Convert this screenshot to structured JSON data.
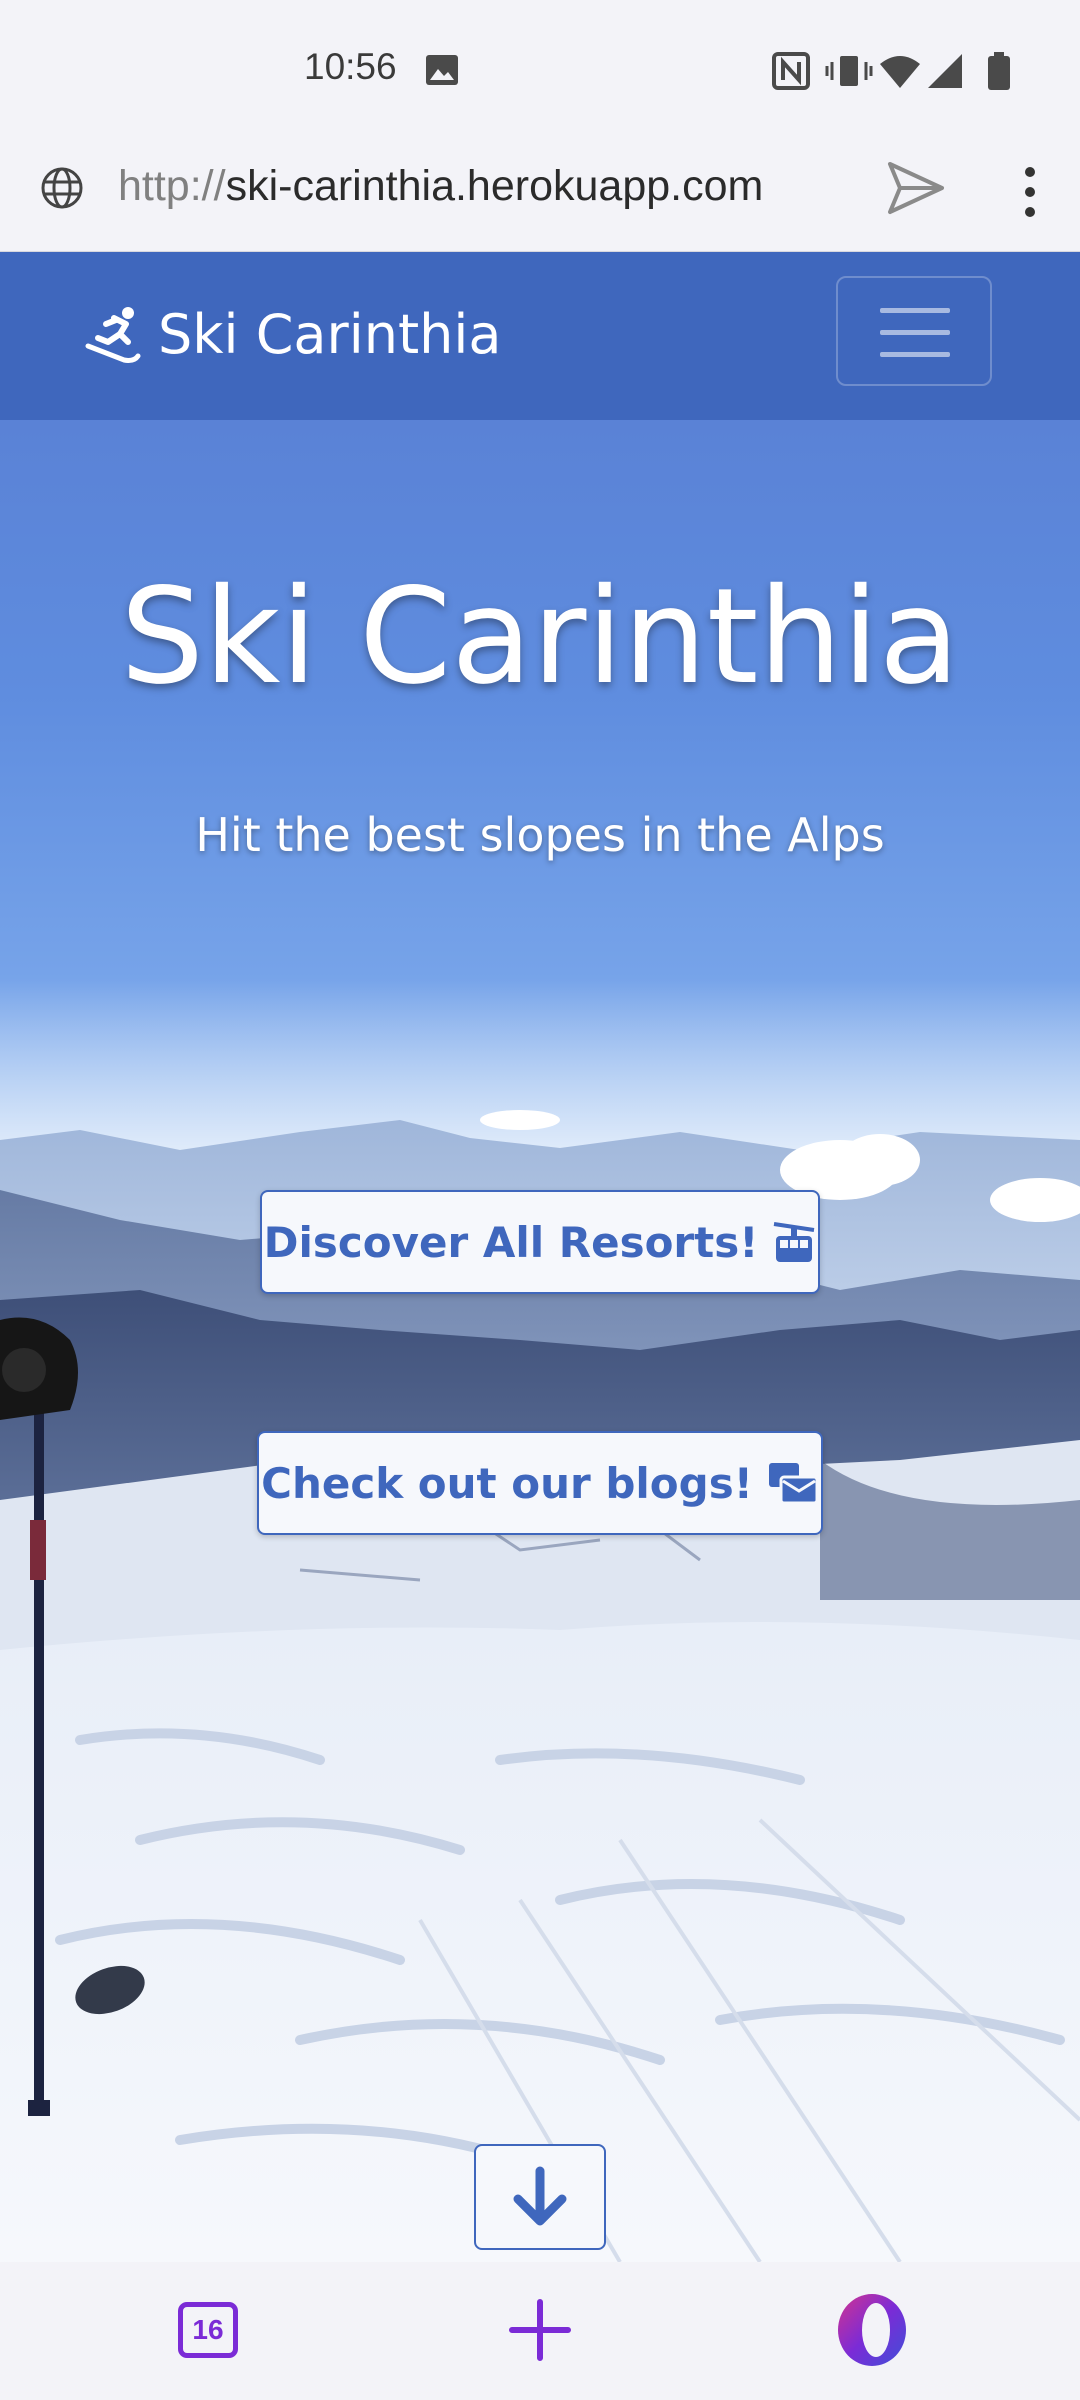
{
  "status_bar": {
    "time": "10:56",
    "icons": [
      "image-icon",
      "nfc-icon",
      "vibrate-icon",
      "wifi-icon",
      "signal-icon",
      "battery-icon"
    ]
  },
  "address_bar": {
    "url_scheme": "http://",
    "url_host": "ski-carinthia.herokuapp.com",
    "icons": [
      "globe-icon",
      "send-icon",
      "more-vertical-icon"
    ]
  },
  "navbar": {
    "brand": "Ski Carinthia",
    "brand_icon": "skier-icon",
    "menu_icon": "hamburger-icon",
    "color": "#3f67bd"
  },
  "hero": {
    "title": "Ski Carinthia",
    "subtitle": "Hit the best slopes in the Alps",
    "resorts_button": "Discover All Resorts!",
    "resorts_icon": "cable-car-icon",
    "blogs_button": "Check out our blogs!",
    "blogs_icon": "mail-bulk-icon",
    "scroll_icon": "arrow-down-icon"
  },
  "bottom_bar": {
    "tab_count": "16",
    "add_icon": "plus-icon",
    "menu_icon": "opera-icon",
    "accent": "#7b2bd6"
  }
}
